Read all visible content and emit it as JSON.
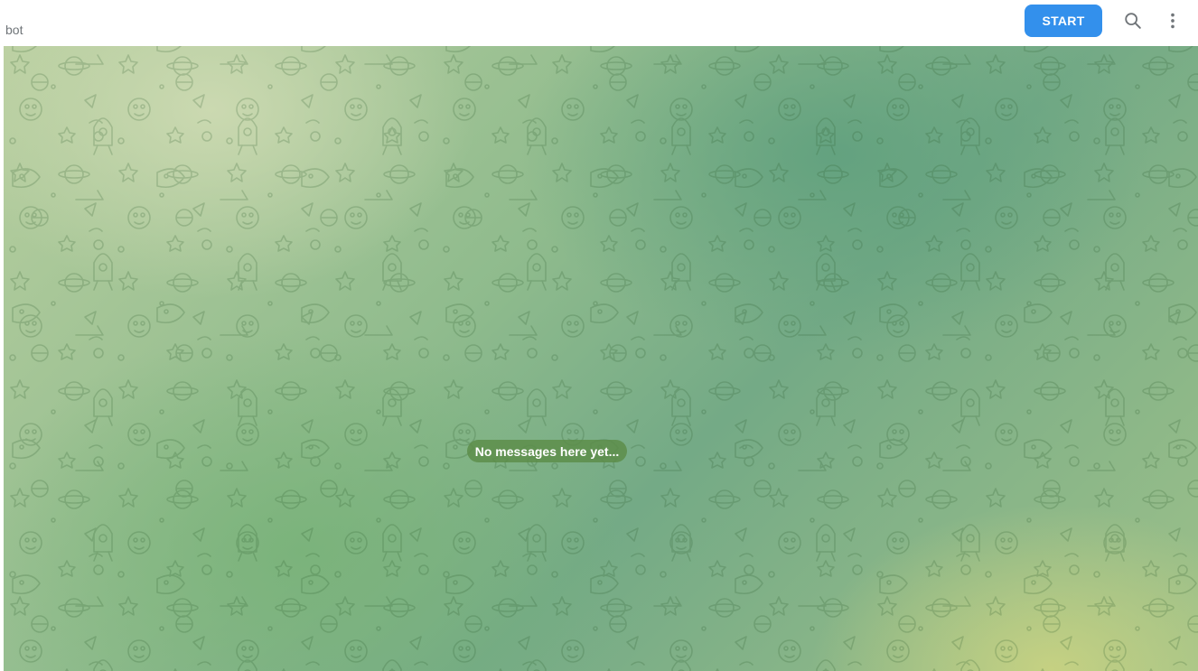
{
  "header": {
    "title": "bot",
    "start_label": "START",
    "search_icon": "search-icon",
    "more_icon": "more-vertical-icon"
  },
  "chat": {
    "empty_message": "No messages here yet..."
  },
  "colors": {
    "accent": "#3390ec",
    "title_text": "#707579",
    "badge_bg": "#5c8c48"
  }
}
